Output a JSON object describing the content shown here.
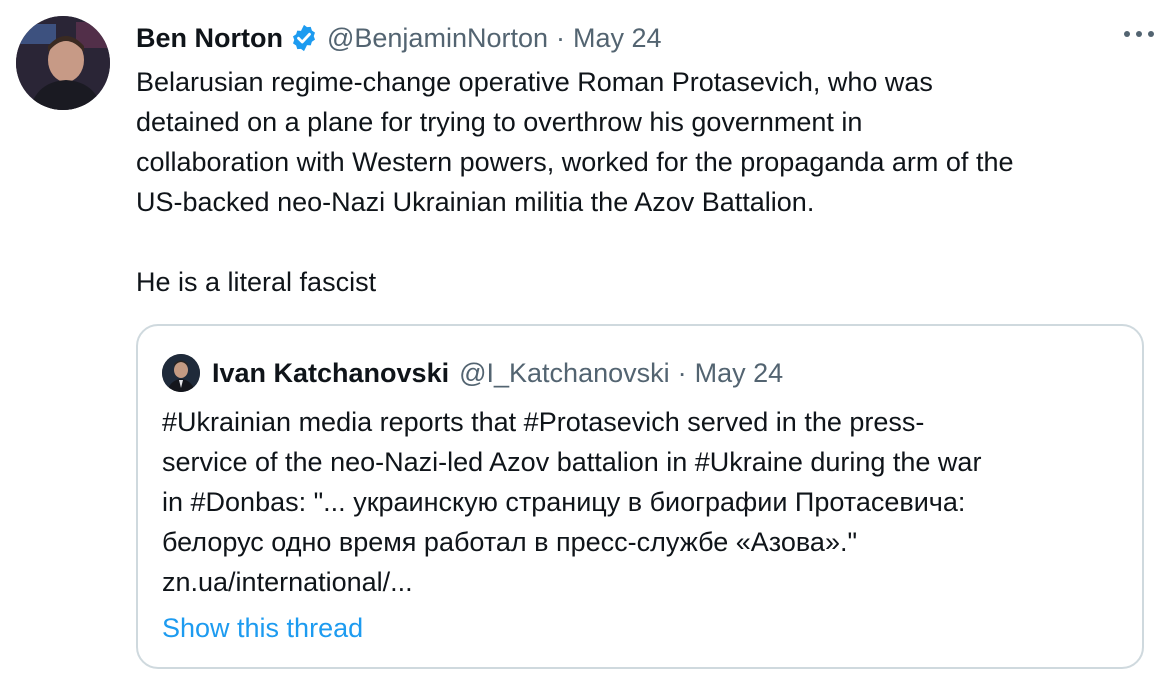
{
  "tweet": {
    "author_name": "Ben Norton",
    "author_handle": "@BenjaminNorton",
    "separator": "·",
    "date": "May 24",
    "text": "Belarusian regime-change operative Roman Protasevich, who was\ndetained on a plane for trying to overthrow his government in\ncollaboration with Western powers, worked for the propaganda arm of the\nUS-backed neo-Nazi Ukrainian militia the Azov Battalion.\n\nHe is a literal fascist",
    "verified_icon": "verified-badge-icon",
    "more_icon": "more-options-icon"
  },
  "quote": {
    "author_name": "Ivan Katchanovski",
    "author_handle": "@I_Katchanovski",
    "separator": "·",
    "date": "May 24",
    "text": "#Ukrainian media reports that #Protasevich served in the press-\nservice of the neo-Nazi-led Azov battalion in #Ukraine during the war\nin #Donbas: \"... украинскую страницу в биографии Протасевича:\nбелорус одно время работал в пресс-службе «Азова».\"\nzn.ua/international/...",
    "show_thread": "Show this thread"
  },
  "colors": {
    "text": "#0f1419",
    "secondary": "#536471",
    "link": "#1d9bf0",
    "border": "#cfd9de",
    "verified": "#1d9bf0"
  }
}
